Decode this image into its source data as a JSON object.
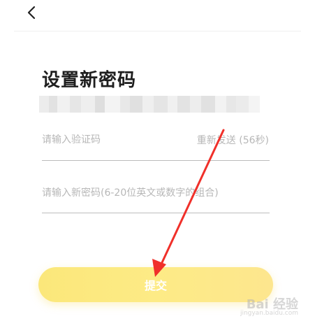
{
  "header": {
    "back_icon": "chevron-left-icon"
  },
  "title": "设置新密码",
  "verification_code": {
    "placeholder": "请输入验证码",
    "resend_label": "重新发送 (56秒)"
  },
  "new_password": {
    "placeholder": "请输入新密码(6-20位英文或数字的组合)"
  },
  "submit": {
    "label": "提交"
  },
  "colors": {
    "submit_gradient_start": "#fbe77a",
    "submit_gradient_end": "#fde68e",
    "arrow": "#f0302a",
    "placeholder": "#b7b7b7"
  },
  "watermark": {
    "main": "Bai 经验",
    "sub": "jingyan.baidu.com"
  }
}
